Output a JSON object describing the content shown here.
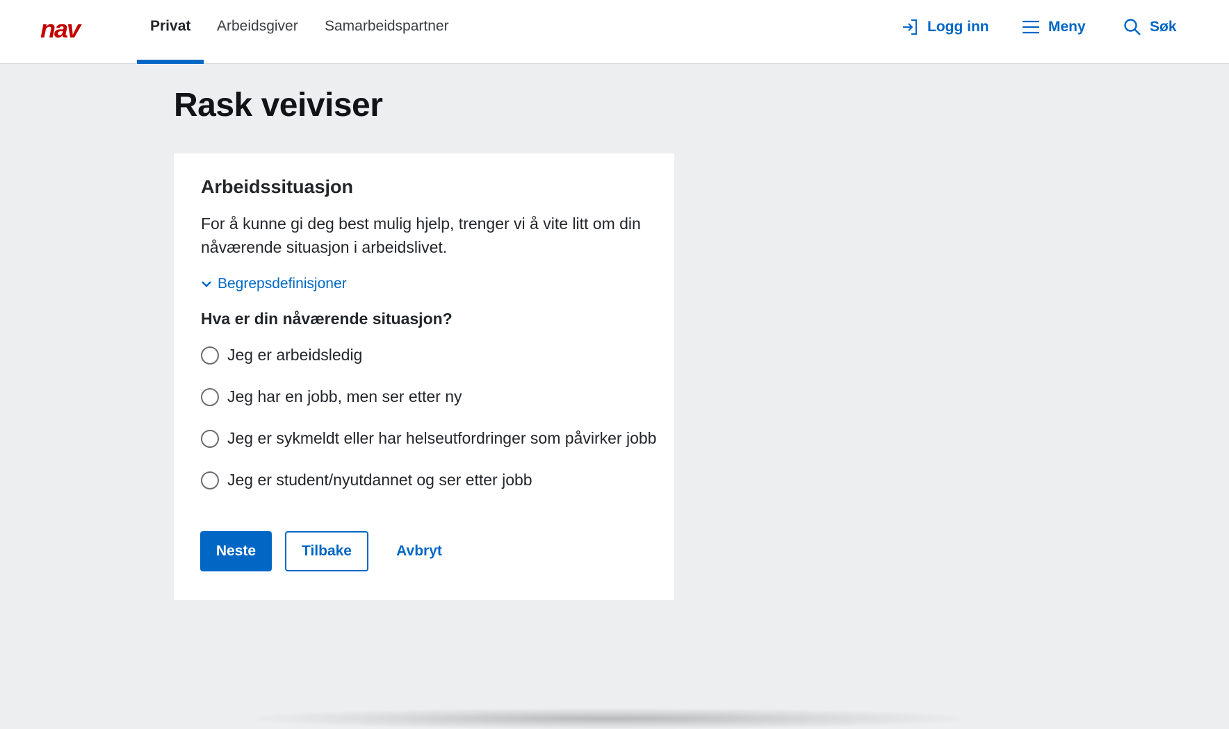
{
  "header": {
    "logo_text": "nav",
    "tabs": [
      {
        "label": "Privat",
        "active": true
      },
      {
        "label": "Arbeidsgiver",
        "active": false
      },
      {
        "label": "Samarbeidspartner",
        "active": false
      }
    ],
    "login_label": "Logg inn",
    "menu_label": "Meny",
    "search_label": "Søk"
  },
  "main": {
    "title": "Rask veiviser",
    "card": {
      "heading": "Arbeidssituasjon",
      "intro": "For å kunne gi deg best mulig hjelp, trenger vi å vite litt om din nåværende situasjon i arbeidslivet.",
      "expander_label": "Begrepsdefinisjoner",
      "question": "Hva er din nåværende situasjon?",
      "options": [
        {
          "label": "Jeg er arbeidsledig",
          "selected": false
        },
        {
          "label": "Jeg har en jobb, men ser etter ny",
          "selected": false
        },
        {
          "label": "Jeg er sykmeldt eller har helseutfordringer som påvirker jobb",
          "selected": false
        },
        {
          "label": "Jeg er student/nyutdannet og ser etter jobb",
          "selected": false
        }
      ],
      "buttons": {
        "next": "Neste",
        "back": "Tilbake",
        "cancel": "Avbryt"
      }
    }
  },
  "colors": {
    "brand_red": "#c30000",
    "accent_blue": "#0067c5",
    "page_background": "#eceef0"
  },
  "icons": {
    "login": "login-arrow-icon",
    "menu": "hamburger-menu-icon",
    "search": "magnifier-icon",
    "expander": "chevron-down-icon"
  }
}
